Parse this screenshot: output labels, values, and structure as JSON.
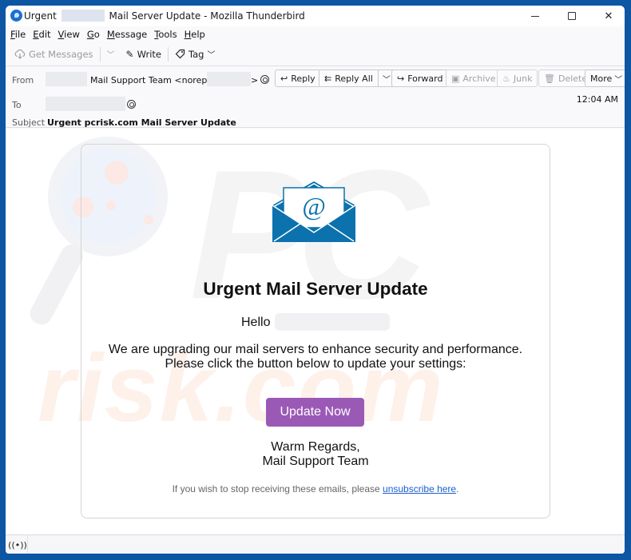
{
  "window": {
    "title_prefix": "Urgent",
    "title_suffix": "Mail Server Update - Mozilla Thunderbird",
    "accent": "#0d56a4"
  },
  "menu": [
    {
      "label": "File",
      "u": "F",
      "rest": "ile"
    },
    {
      "label": "Edit",
      "u": "E",
      "rest": "dit"
    },
    {
      "label": "View",
      "u": "V",
      "rest": "iew"
    },
    {
      "label": "Go",
      "u": "G",
      "rest": "o"
    },
    {
      "label": "Message",
      "u": "M",
      "rest": "essage"
    },
    {
      "label": "Tools",
      "u": "T",
      "rest": "ools"
    },
    {
      "label": "Help",
      "u": "H",
      "rest": "elp"
    }
  ],
  "toolbar": {
    "get_messages": "Get Messages",
    "write": "Write",
    "tag": "Tag"
  },
  "header": {
    "from_label": "From",
    "from_value": "Mail Support Team <noreply@",
    "from_end": ">",
    "to_label": "To",
    "subject_label": "Subject",
    "subject_value": "Urgent pcrisk.com Mail Server Update",
    "time": "12:04 AM",
    "buttons": {
      "reply": "Reply",
      "reply_all": "Reply All",
      "forward": "Forward",
      "archive": "Archive",
      "junk": "Junk",
      "delete": "Delete",
      "more": "More"
    }
  },
  "email": {
    "title": "Urgent Mail Server Update",
    "greeting": "Hello",
    "para_line1": "We are upgrading our mail servers to enhance security and performance.",
    "para_line2": "Please click the button below to update your settings:",
    "cta": "Update Now",
    "cta_color": "#9b59b6",
    "sign_line1": "Warm Regards,",
    "sign_line2": "Mail Support Team",
    "footer_text": "If you wish to stop receiving these emails, please ",
    "footer_link": "unsubscribe here",
    "footer_end": "."
  },
  "watermark": {
    "top": "PC",
    "bottom": "risk.com"
  }
}
